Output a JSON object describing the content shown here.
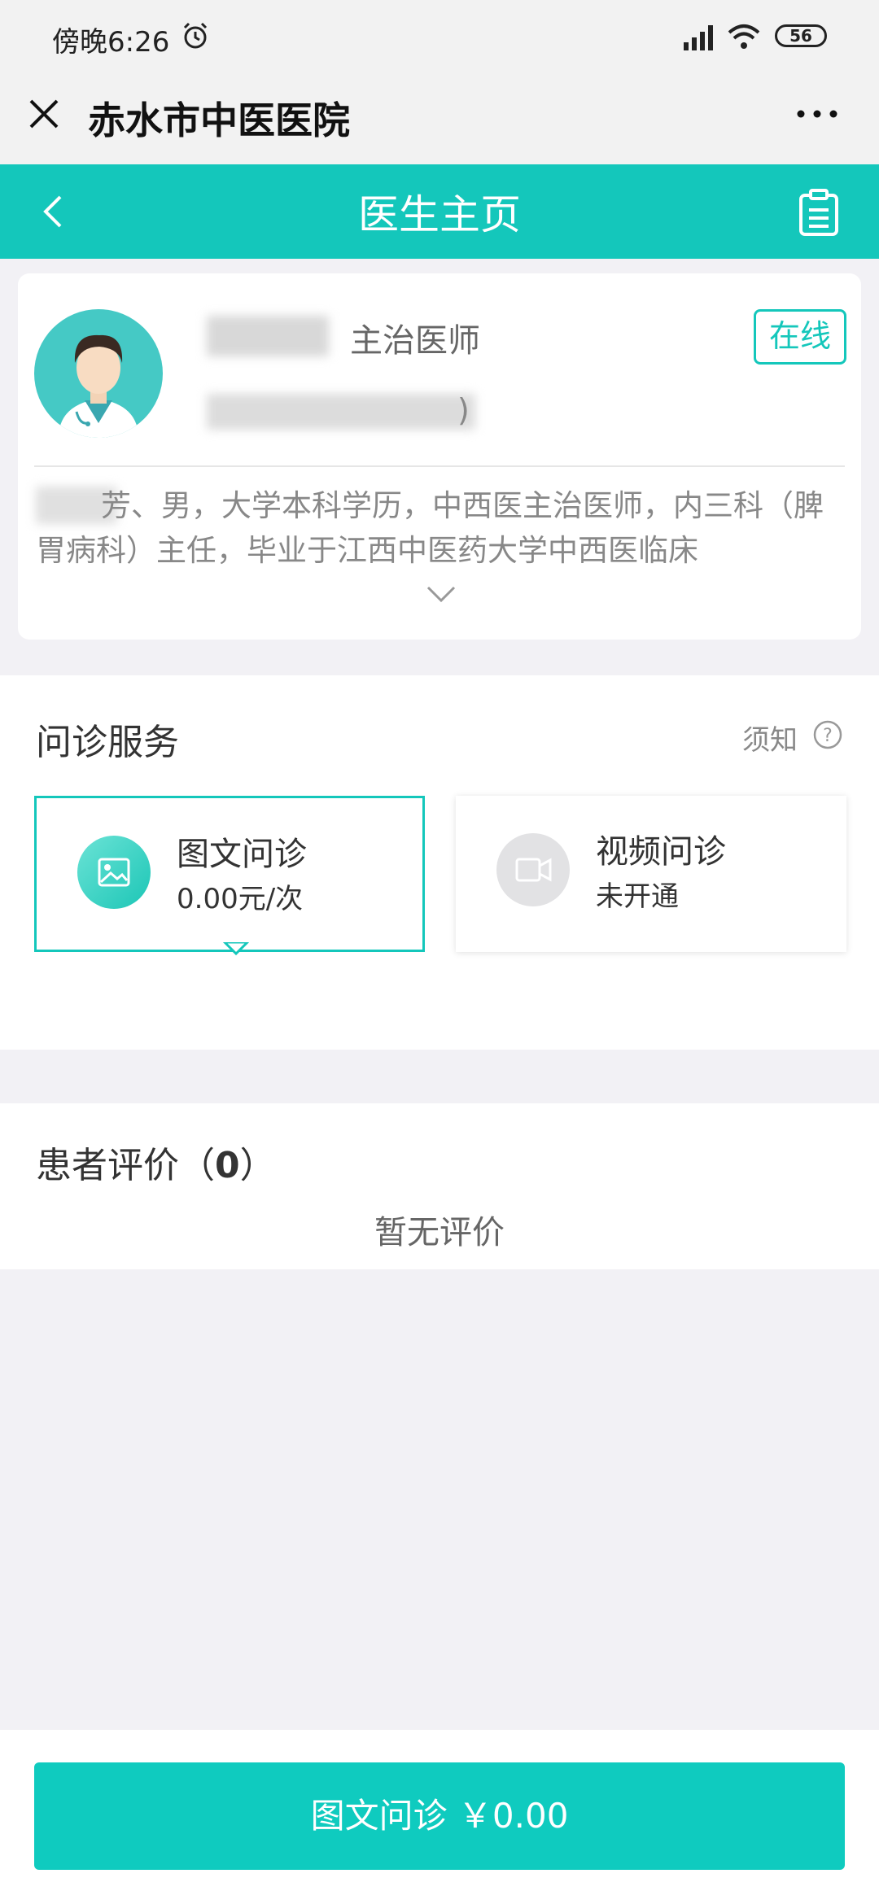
{
  "status_bar": {
    "time": "傍晚6:26",
    "battery": "56"
  },
  "wechat_bar": {
    "title": "赤水市中医医院"
  },
  "navbar": {
    "title": "医生主页"
  },
  "doctor": {
    "title": "主治医师",
    "status": "在线",
    "department_suffix": ")",
    "intro": "芳、男，大学本科学历，中西医主治医师，内三科（脾胃病科）主任，毕业于江西中医药大学中西医临床"
  },
  "services": {
    "title": "问诊服务",
    "notice": "须知",
    "items": [
      {
        "name": "图文问诊",
        "sub": "0.00元/次",
        "active": true
      },
      {
        "name": "视频问诊",
        "sub": "未开通",
        "active": false
      }
    ]
  },
  "reviews": {
    "title": "患者评价（",
    "count": "0",
    "title_end": "）",
    "empty": "暂无评价"
  },
  "bottom": {
    "button": "图文问诊 ￥0.00"
  },
  "colors": {
    "accent": "#14c7bb",
    "button": "#0fcbbf",
    "background": "#f2f1f5"
  }
}
